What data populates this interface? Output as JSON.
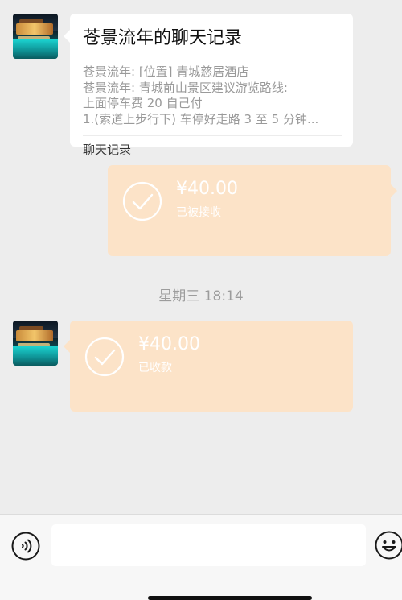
{
  "chat_record": {
    "title": "苍景流年的聊天记录",
    "lines": [
      "苍景流年: [位置] 青城慈居酒店",
      "苍景流年: 青城前山景区建议游览路线:",
      "上面停车费 20 自己付",
      "1.(索道上步行下) 车停好走路 3 至 5 分钟..."
    ],
    "footer": "聊天记录"
  },
  "messages": [
    {
      "side": "right",
      "amount": "¥40.00",
      "status": "已被接收"
    },
    {
      "side": "left",
      "amount": "¥40.00",
      "status": "已收款"
    }
  ],
  "timestamp": "星期三 18:14",
  "icons": {
    "voice": "voice-icon",
    "emoji": "emoji-icon",
    "check": "check-circle-icon"
  },
  "colors": {
    "background": "#ededed",
    "transfer_bubble": "#fce3c8",
    "card": "#ffffff"
  }
}
